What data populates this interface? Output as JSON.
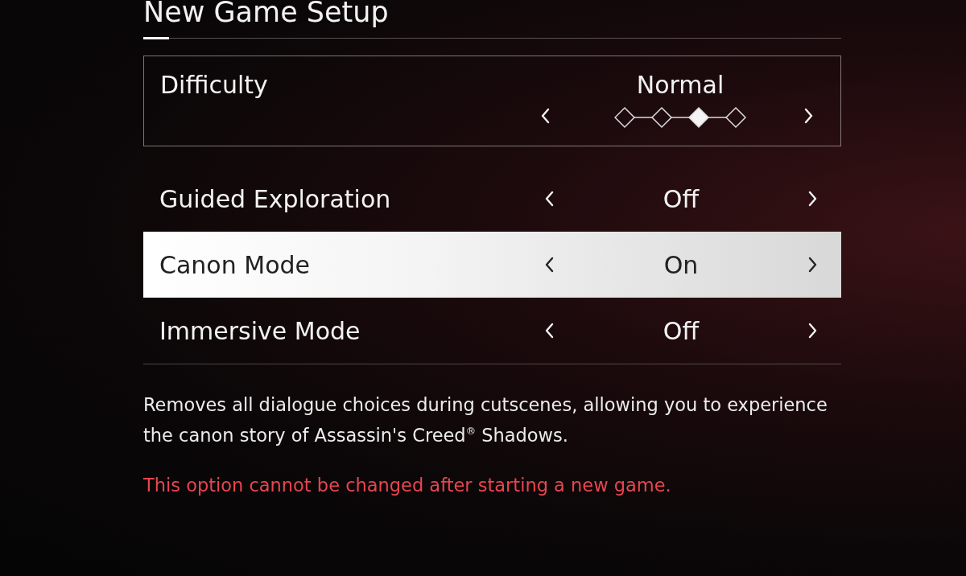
{
  "title": "New Game Setup",
  "difficulty": {
    "label": "Difficulty",
    "value": "Normal",
    "steps": [
      {
        "selected": false
      },
      {
        "selected": false
      },
      {
        "selected": true
      },
      {
        "selected": false
      }
    ]
  },
  "options": [
    {
      "label": "Guided Exploration",
      "value": "Off",
      "selected": false
    },
    {
      "label": "Canon Mode",
      "value": "On",
      "selected": true
    },
    {
      "label": "Immersive Mode",
      "value": "Off",
      "selected": false
    }
  ],
  "description": "Removes all dialogue choices during cutscenes, allowing you to experience the canon story of Assassin's Creed$^{®}$ Shadows.",
  "warning": "This option cannot be changed after starting a new game."
}
